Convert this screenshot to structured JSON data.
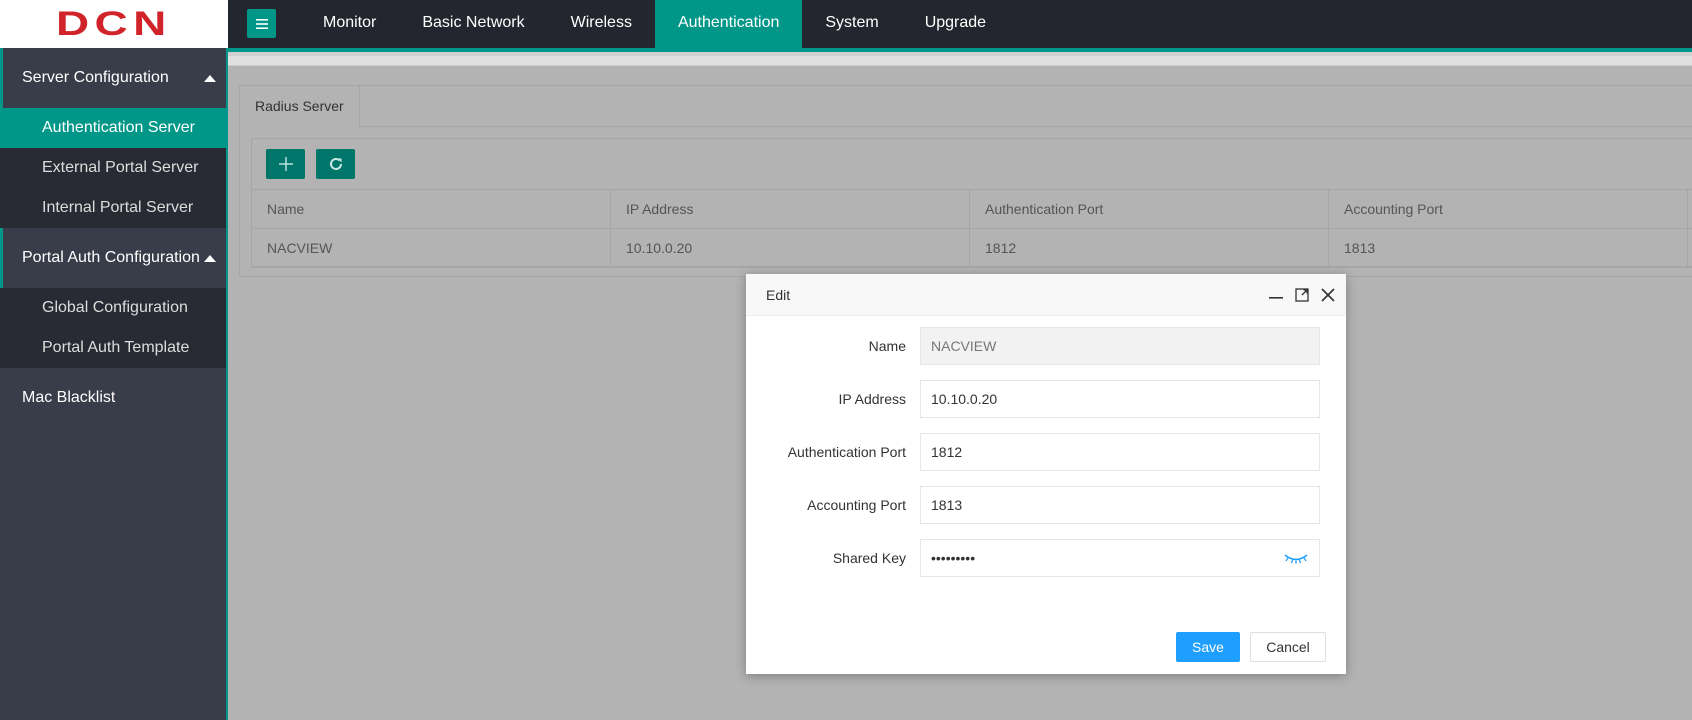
{
  "brand": {
    "logo_text": "DCN"
  },
  "topnav": {
    "items": [
      {
        "label": "Monitor"
      },
      {
        "label": "Basic Network"
      },
      {
        "label": "Wireless"
      },
      {
        "label": "Authentication",
        "active": true
      },
      {
        "label": "System"
      },
      {
        "label": "Upgrade"
      }
    ]
  },
  "sidebar": {
    "groups": [
      {
        "label": "Server Configuration",
        "expanded": true,
        "items": [
          {
            "label": "Authentication Server",
            "active": true
          },
          {
            "label": "External Portal Server"
          },
          {
            "label": "Internal Portal Server"
          }
        ]
      },
      {
        "label": "Portal Auth Configuration",
        "expanded": true,
        "items": [
          {
            "label": "Global Configuration"
          },
          {
            "label": "Portal Auth Template"
          }
        ]
      },
      {
        "label": "Mac Blacklist",
        "expanded": false,
        "items": []
      }
    ]
  },
  "main": {
    "tab_label": "Radius Server",
    "toolbar": {
      "add_icon": "plus-icon",
      "refresh_icon": "refresh-icon"
    },
    "table": {
      "headers": [
        "Name",
        "IP Address",
        "Authentication Port",
        "Accounting Port"
      ],
      "rows": [
        [
          "NACVIEW",
          "10.10.0.20",
          "1812",
          "1813"
        ]
      ]
    }
  },
  "modal": {
    "title": "Edit",
    "fields": {
      "name": {
        "label": "Name",
        "value": "NACVIEW"
      },
      "ip": {
        "label": "IP Address",
        "value": "10.10.0.20"
      },
      "auth_port": {
        "label": "Authentication Port",
        "value": "1812"
      },
      "acct_port": {
        "label": "Accounting Port",
        "value": "1813"
      },
      "shared_key": {
        "label": "Shared Key",
        "value": "•••••••••"
      }
    },
    "save_label": "Save",
    "cancel_label": "Cancel"
  },
  "colors": {
    "accent": "#009688",
    "primary_button": "#1e9fff",
    "brand_red": "#d0232a"
  }
}
